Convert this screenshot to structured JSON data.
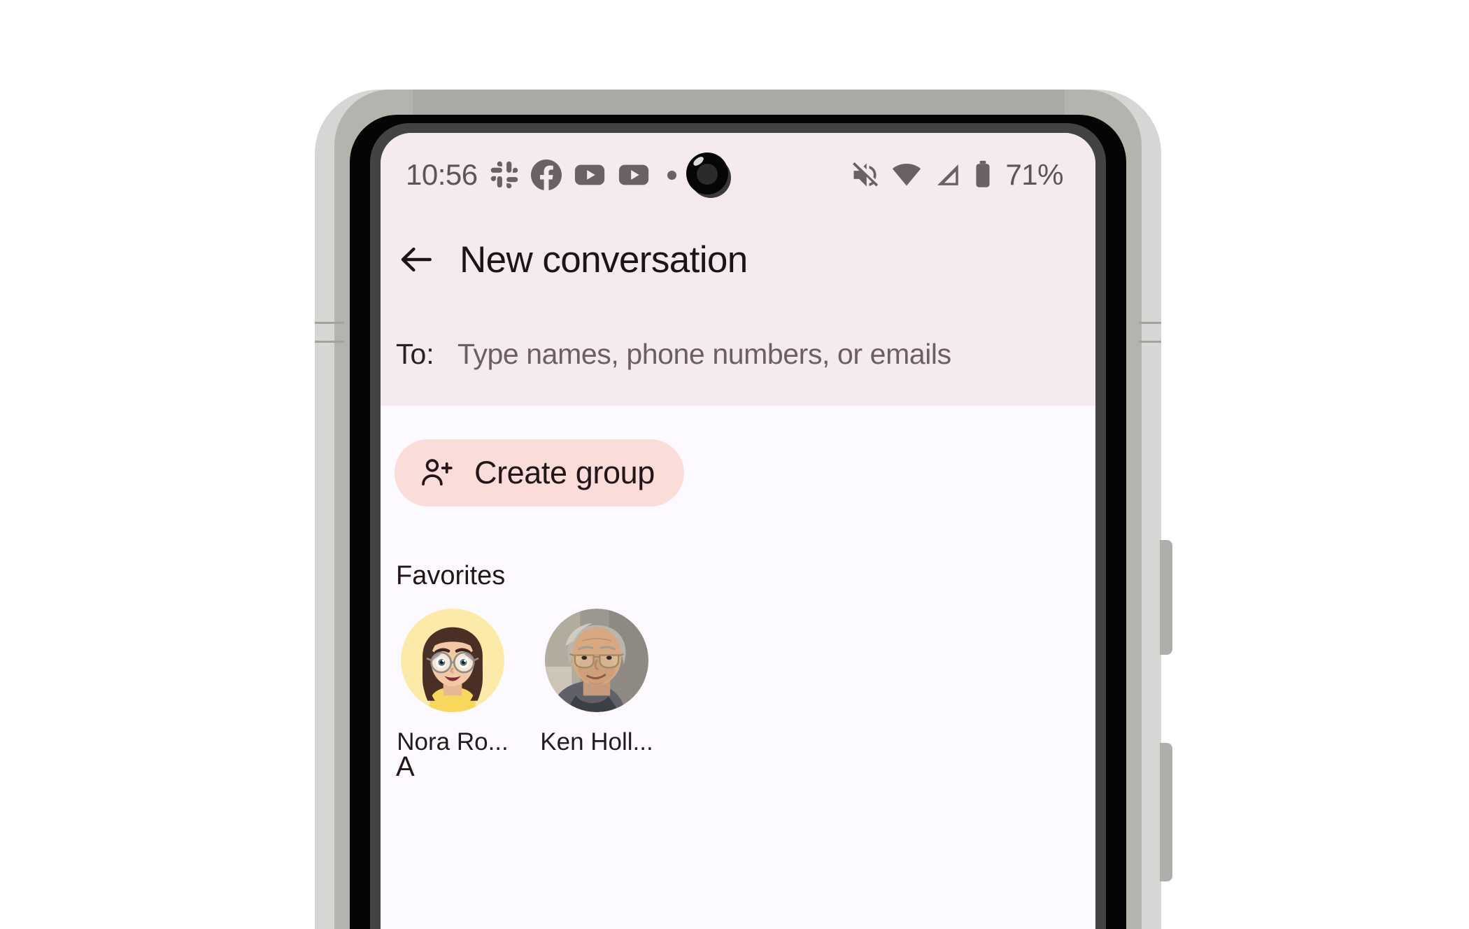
{
  "device": {
    "type": "android-phone",
    "frame_color": "#d6d6d4",
    "screen_bg": "#fdfaff"
  },
  "status_bar": {
    "time": "10:56",
    "battery_percent": "71%",
    "background": "#f5eaec",
    "foreground": "#5d5458",
    "notification_icons": [
      {
        "name": "slack-icon",
        "label": "Slack"
      },
      {
        "name": "facebook-icon",
        "label": "Facebook"
      },
      {
        "name": "youtube-icon",
        "label": "YouTube"
      },
      {
        "name": "youtube-icon-2",
        "label": "YouTube"
      },
      {
        "name": "overflow-dot-icon",
        "label": "More notifications"
      }
    ],
    "system_icons": [
      {
        "name": "volume-muted-icon",
        "label": "Ringer muted"
      },
      {
        "name": "wifi-icon",
        "label": "Wi-Fi full signal"
      },
      {
        "name": "cellular-signal-icon",
        "label": "Mobile signal"
      },
      {
        "name": "battery-icon",
        "label": "Battery"
      }
    ]
  },
  "app_bar": {
    "back_label": "Back",
    "title": "New conversation"
  },
  "recipient_field": {
    "label": "To:",
    "value": "",
    "placeholder": "Type names, phone numbers, or emails"
  },
  "actions": {
    "create_group_label": "Create group",
    "create_group_bg": "#fadcd9",
    "create_group_fg": "#231619"
  },
  "sections": {
    "favorites_header": "Favorites",
    "alpha_header": "A"
  },
  "favorites": [
    {
      "name": "Nora Ro...",
      "avatar_type": "memoji",
      "avatar_bg": "#fbeaa8"
    },
    {
      "name": "Ken Holl...",
      "avatar_type": "photo",
      "avatar_bg": "#8f8d88"
    }
  ],
  "side_buttons": [
    {
      "name": "power-button",
      "label": "Power"
    },
    {
      "name": "volume-button",
      "label": "Volume"
    }
  ]
}
